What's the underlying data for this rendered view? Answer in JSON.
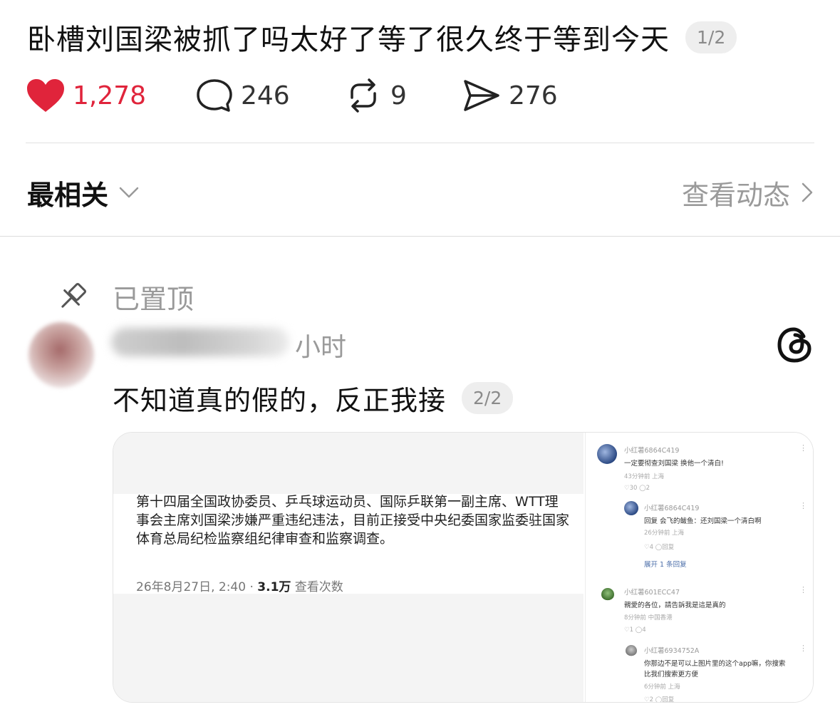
{
  "post": {
    "title": "卧槽刘国梁被抓了吗太好了等了很久终于等到今天",
    "page_indicator": "1/2"
  },
  "actions": {
    "likes": "1,278",
    "comments": "246",
    "reposts": "9",
    "shares": "276"
  },
  "colors": {
    "like": "#e0243b",
    "secondary_text": "#9a9a9a"
  },
  "sort": {
    "label": "最相关",
    "view_activity": "查看动态"
  },
  "reply": {
    "pinned_label": "已置顶",
    "time": "小时",
    "text": "不知道真的假的，反正我接",
    "page_indicator": "2/2"
  },
  "embedded": {
    "news_text": "第十四届全国政协委员、乒乓球运动员、国际乒联第一副主席、WTT理事会主席刘国梁涉嫌严重违纪违法，目前正接受中央纪委国家监委驻国家体育总局纪检监察组纪律审查和监察调查。",
    "date": "26年8月27日, 2:40 · ",
    "views": "3.1万",
    "views_label": " 查看次数",
    "comments": [
      {
        "user": "小红薯6864C419",
        "text": "一定要彻查刘国梁 换他一个清白!",
        "meta": "43分钟前 上海",
        "stats": "♡30  ◯2"
      },
      {
        "user": "小红薯6864C419",
        "text": "回复 会飞的鲅鱼：还刘国梁一个清白啊",
        "meta": "26分钟前 上海",
        "stats": "♡4  ◯回复"
      },
      {
        "expand": "展开 1 条回复"
      },
      {
        "user": "小红薯601ECC47",
        "text": "親愛的各位，請告訴我是這是真的",
        "meta": "8分钟前 中国香港",
        "stats": "♡1  ◯4"
      },
      {
        "user": "小红薯6934752A",
        "text": "你那边不是可以上图片里的这个app嘛，你搜索",
        "text2": "比我们搜索更方便",
        "meta": "6分钟前 上海",
        "stats": "♡2  ◯回复"
      }
    ]
  }
}
